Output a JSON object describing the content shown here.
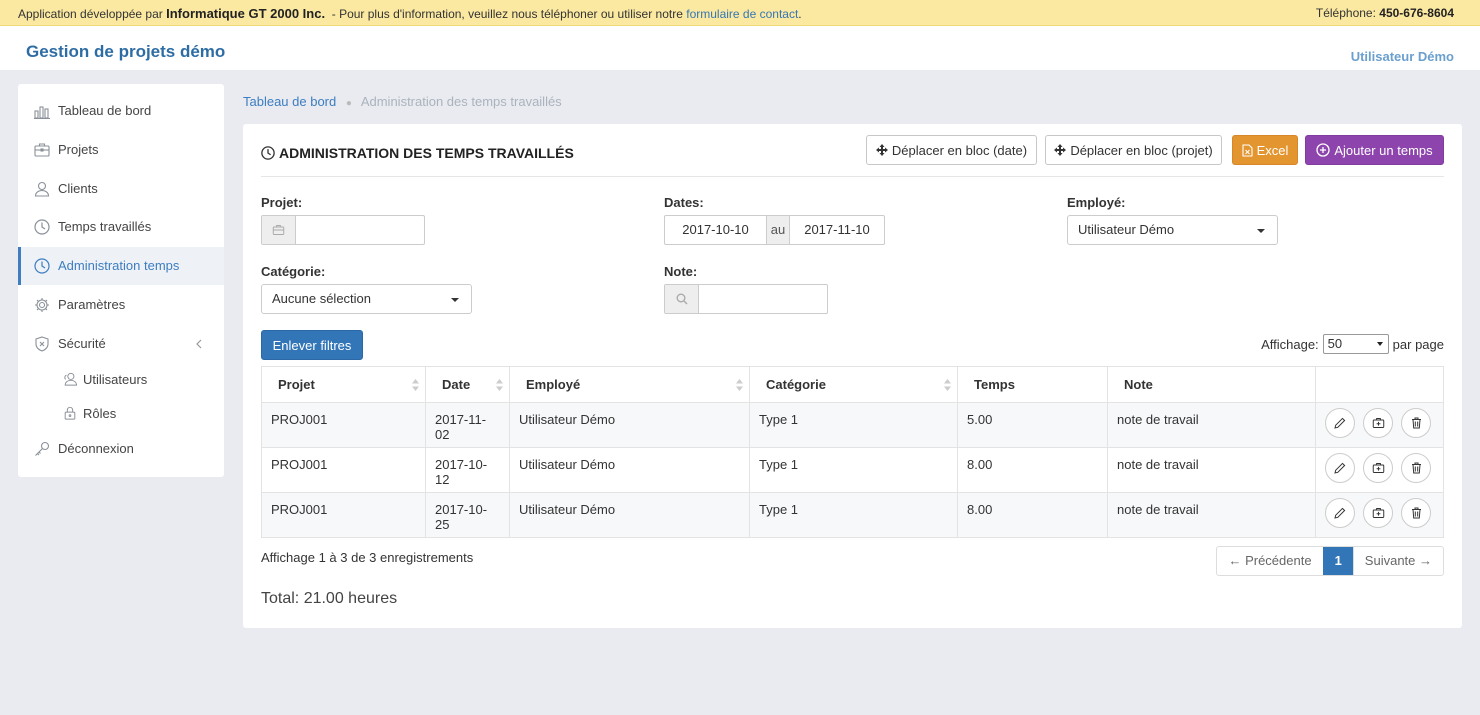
{
  "topbar": {
    "prefix": "Application développée par",
    "company": "Informatique GT 2000 Inc.",
    "message": "- Pour plus d'information, veuillez nous téléphoner ou utiliser notre",
    "contact_link": "formulaire de contact",
    "period": ".",
    "phone_label": "Téléphone:",
    "phone": "450-676-8604"
  },
  "header": {
    "brand": "Gestion de projets démo",
    "user": "Utilisateur Démo"
  },
  "sidebar": {
    "items": [
      {
        "label": "Tableau de bord",
        "icon": "bar-chart-icon"
      },
      {
        "label": "Projets",
        "icon": "briefcase-icon"
      },
      {
        "label": "Clients",
        "icon": "user-icon"
      },
      {
        "label": "Temps travaillés",
        "icon": "clock-icon"
      },
      {
        "label": "Administration temps",
        "icon": "clock-icon",
        "active": true
      },
      {
        "label": "Paramètres",
        "icon": "gear-icon"
      },
      {
        "label": "Sécurité",
        "icon": "shield-icon"
      },
      {
        "label": "Utilisateurs",
        "icon": "users-icon"
      },
      {
        "label": "Rôles",
        "icon": "lock-icon"
      },
      {
        "label": "Déconnexion",
        "icon": "key-icon"
      }
    ]
  },
  "breadcrumb": {
    "home": "Tableau de bord",
    "current": "Administration des temps travaillés"
  },
  "panel": {
    "title": "ADMINISTRATION DES TEMPS TRAVAILLÉS",
    "buttons": {
      "move_date": "Déplacer en bloc (date)",
      "move_project": "Déplacer en bloc (projet)",
      "excel": "Excel",
      "add": "Ajouter un temps"
    }
  },
  "filters": {
    "project_label": "Projet:",
    "project_value": "",
    "dates_label": "Dates:",
    "date_from": "2017-10-10",
    "date_sep": "au",
    "date_to": "2017-11-10",
    "employee_label": "Employé:",
    "employee_value": "Utilisateur Démo",
    "category_label": "Catégorie:",
    "category_value": "Aucune sélection",
    "note_label": "Note:",
    "note_value": "",
    "clear_button": "Enlever filtres"
  },
  "paging": {
    "prefix": "Affichage:",
    "per_page": "50",
    "suffix": "par page"
  },
  "table": {
    "headers": [
      "Projet",
      "Date",
      "Employé",
      "Catégorie",
      "Temps",
      "Note"
    ],
    "rows": [
      [
        "PROJ001",
        "2017-11-02",
        "Utilisateur Démo",
        "Type 1",
        "5.00",
        "note de travail"
      ],
      [
        "PROJ001",
        "2017-10-12",
        "Utilisateur Démo",
        "Type 1",
        "8.00",
        "note de travail"
      ],
      [
        "PROJ001",
        "2017-10-25",
        "Utilisateur Démo",
        "Type 1",
        "8.00",
        "note de travail"
      ]
    ]
  },
  "footer": {
    "info": "Affichage 1 à 3 de 3 enregistrements",
    "total": "Total: 21.00 heures",
    "prev": "← Précédente",
    "page": "1",
    "next": "Suivante →"
  },
  "colors": {
    "accent": "#3376b8",
    "excel": "#e3952f",
    "add": "#8e44ad",
    "banner": "#fbe9a2"
  }
}
